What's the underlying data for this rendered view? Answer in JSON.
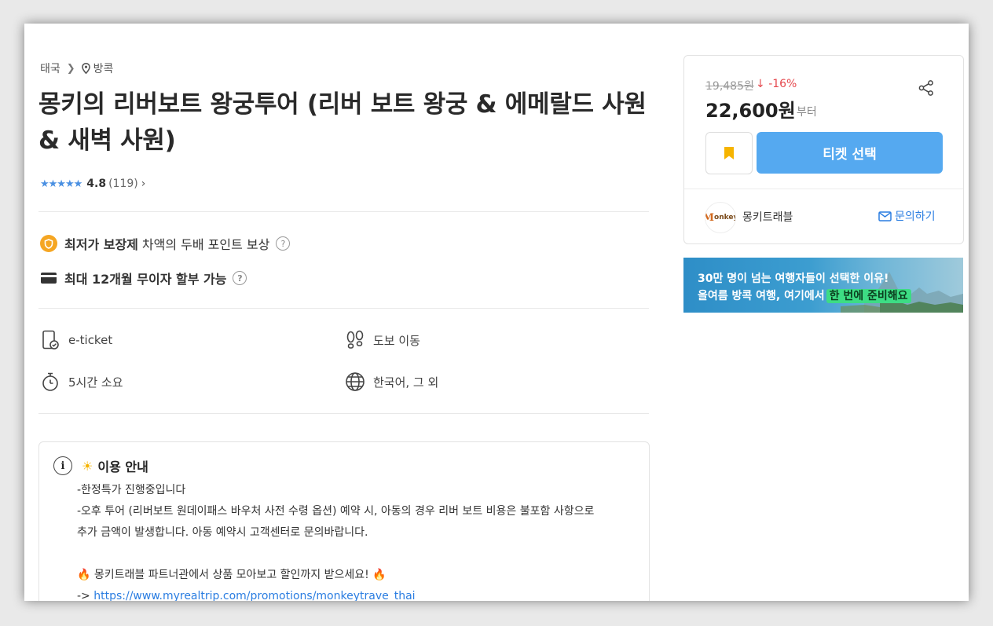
{
  "breadcrumb": {
    "country": "태국",
    "city": "방콕"
  },
  "product": {
    "title": "몽키의 리버보트 왕궁투어 (리버 보트 왕궁 & 에메랄드 사원 & 새벽 사원)",
    "rating": {
      "stars": "★★★★★",
      "value": "4.8",
      "count": "(119)"
    }
  },
  "benefits": {
    "guarantee_bold": "최저가 보장제",
    "guarantee_text": "차액의 두배 포인트 보상",
    "installment": "최대 12개월 무이자 할부 가능"
  },
  "features": {
    "ticket": "e-ticket",
    "move": "도보 이동",
    "duration": "5시간 소요",
    "language": "한국어, 그 외"
  },
  "notice": {
    "heading": "이용 안내",
    "line1": "-한정특가 진행중입니다",
    "line2": "-오후 투어 (리버보트 원데이패스 바우처 사전 수령 옵션) 예약 시, 아동의 경우 리버 보트 비용은 불포함 사항으로",
    "line3": "추가 금액이 발생합니다. 아동 예약시 고객센터로 문의바랍니다.",
    "promo": "몽키트래블 파트너관에서 상품 모아보고 할인까지 받으세요!",
    "arrow": "->",
    "link": "https://www.myrealtrip.com/promotions/monkeytrave_thai"
  },
  "purchase": {
    "original_price": "19,485원",
    "discount": "-16%",
    "price": "22,600원",
    "price_suffix": "부터",
    "ticket_button": "티켓 선택"
  },
  "seller": {
    "logo_text": "onkey",
    "name": "몽키트래블",
    "inquiry": "문의하기"
  },
  "banner": {
    "line1": "30만 명이 넘는 여행자들이 선택한 이유!",
    "line2": "올여름 방콕 여행, 여기에서",
    "highlight": "한 번에 준비해요"
  },
  "colors": {
    "accent": "#55a9f0",
    "link": "#2a7de1",
    "discount": "#e5484d",
    "star": "#4a90e2",
    "badge": "#f5a623"
  }
}
